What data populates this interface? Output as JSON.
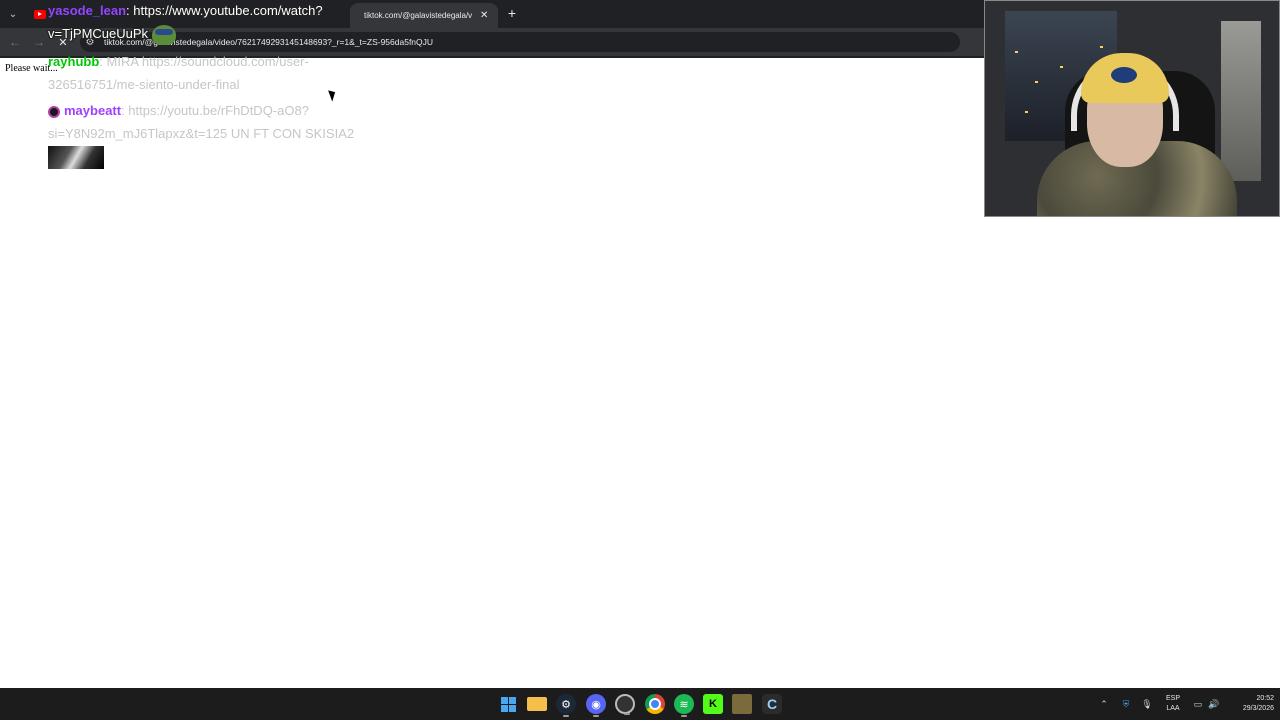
{
  "browser": {
    "tab_list_icon": "chevron-down-icon",
    "tabs": [
      {
        "title": "",
        "favicon": "youtube-icon"
      },
      {
        "title": "tiktok.com/@galavistedegala/v",
        "close_glyph": "✕"
      }
    ],
    "new_tab_glyph": "+",
    "address": "tiktok.com/@galavistedegala/video/7621749293145148693?_r=1&_t=ZS-956da5fnQJU",
    "stop_glyph": "✕"
  },
  "page": {
    "loading_text": "Please wait..."
  },
  "chat": [
    {
      "user": "yasode_lean",
      "user_color": "#9146ff",
      "message": ": https://www.youtube.com/watch?v=TjPMCueUuPk",
      "emote": "pepe-emote"
    },
    {
      "user": "rayhubb",
      "user_color": "#00c800",
      "message": ": MIRA https://soundcloud.com/user-326516751/me-siento-under-final"
    },
    {
      "user": "maybeatt",
      "user_color": "#a040ff",
      "badge": "subscriber-badge",
      "message": ": https://youtu.be/rFhDtDQ-aO8?si=Y8N92m_mJ6Tlapxz&t=125 UN FT CON SKISIA2",
      "emote": "image-emote"
    }
  ],
  "taskbar": {
    "apps": [
      "start-icon",
      "file-explorer-icon",
      "steam-icon",
      "discord-icon",
      "extension-icon",
      "chrome-icon",
      "spotify-icon",
      "kick-icon",
      "minecraft-icon",
      "c-app-icon"
    ],
    "kick_glyph": "K",
    "c_app_glyph": "C",
    "tray": {
      "language_top": "ESP",
      "language_bottom": "LAA",
      "time": "20:52",
      "date": "29/3/2026"
    }
  },
  "colors": {
    "chrome_dark": "#202124",
    "chrome_toolbar": "#35363a",
    "taskbar": "#1c1c1c",
    "page_bg": "#ffffff"
  }
}
